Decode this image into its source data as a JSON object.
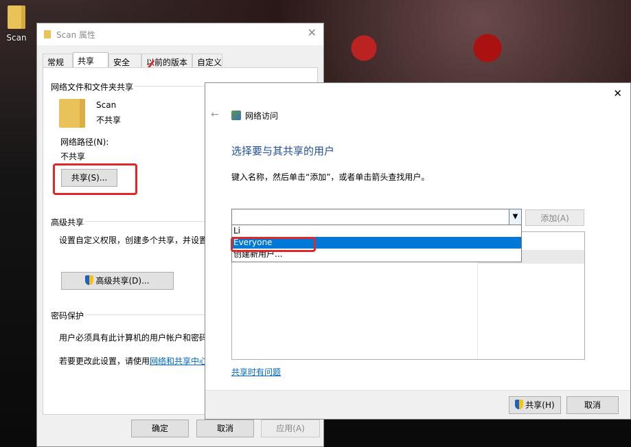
{
  "desktop": {
    "icon_label": "Scan"
  },
  "properties": {
    "title": "Scan 属性",
    "close": "✕",
    "tabs": [
      "常规",
      "共享",
      "安全",
      "以前的版本",
      "自定义"
    ],
    "network_sharing": {
      "heading": "网络文件和文件夹共享",
      "folder_name": "Scan",
      "status": "不共享",
      "path_label": "网络路径(N):",
      "path_value": "不共享",
      "share_button": "共享(S)..."
    },
    "advanced": {
      "heading": "高级共享",
      "description": "设置自定义权限，创建多个共享，并设置",
      "button": "高级共享(D)..."
    },
    "password": {
      "heading": "密码保护",
      "line1": "用户必须具有此计算机的用户帐户和密码",
      "line2_prefix": "若要更改此设置，请使用",
      "line2_link": "网络和共享中心"
    },
    "buttons": {
      "ok": "确定",
      "cancel": "取消",
      "apply": "应用(A)"
    }
  },
  "network_access": {
    "back": "←",
    "title": "网络访问",
    "close": "✕",
    "heading": "选择要与其共享的用户",
    "instruction": "键入名称，然后单击“添加”，或者单击箭头查找用户。",
    "add_button": "添加(A)",
    "dropdown_options": [
      "Li",
      "Everyone",
      "创建新用户..."
    ],
    "selected_option": "Everyone",
    "help_link": "共享时有问题",
    "share_button": "共享(H)",
    "cancel_button": "取消"
  },
  "colors": {
    "accent": "#0078d7",
    "heading_blue": "#1e4e9c",
    "annotation_red": "#e02626"
  }
}
